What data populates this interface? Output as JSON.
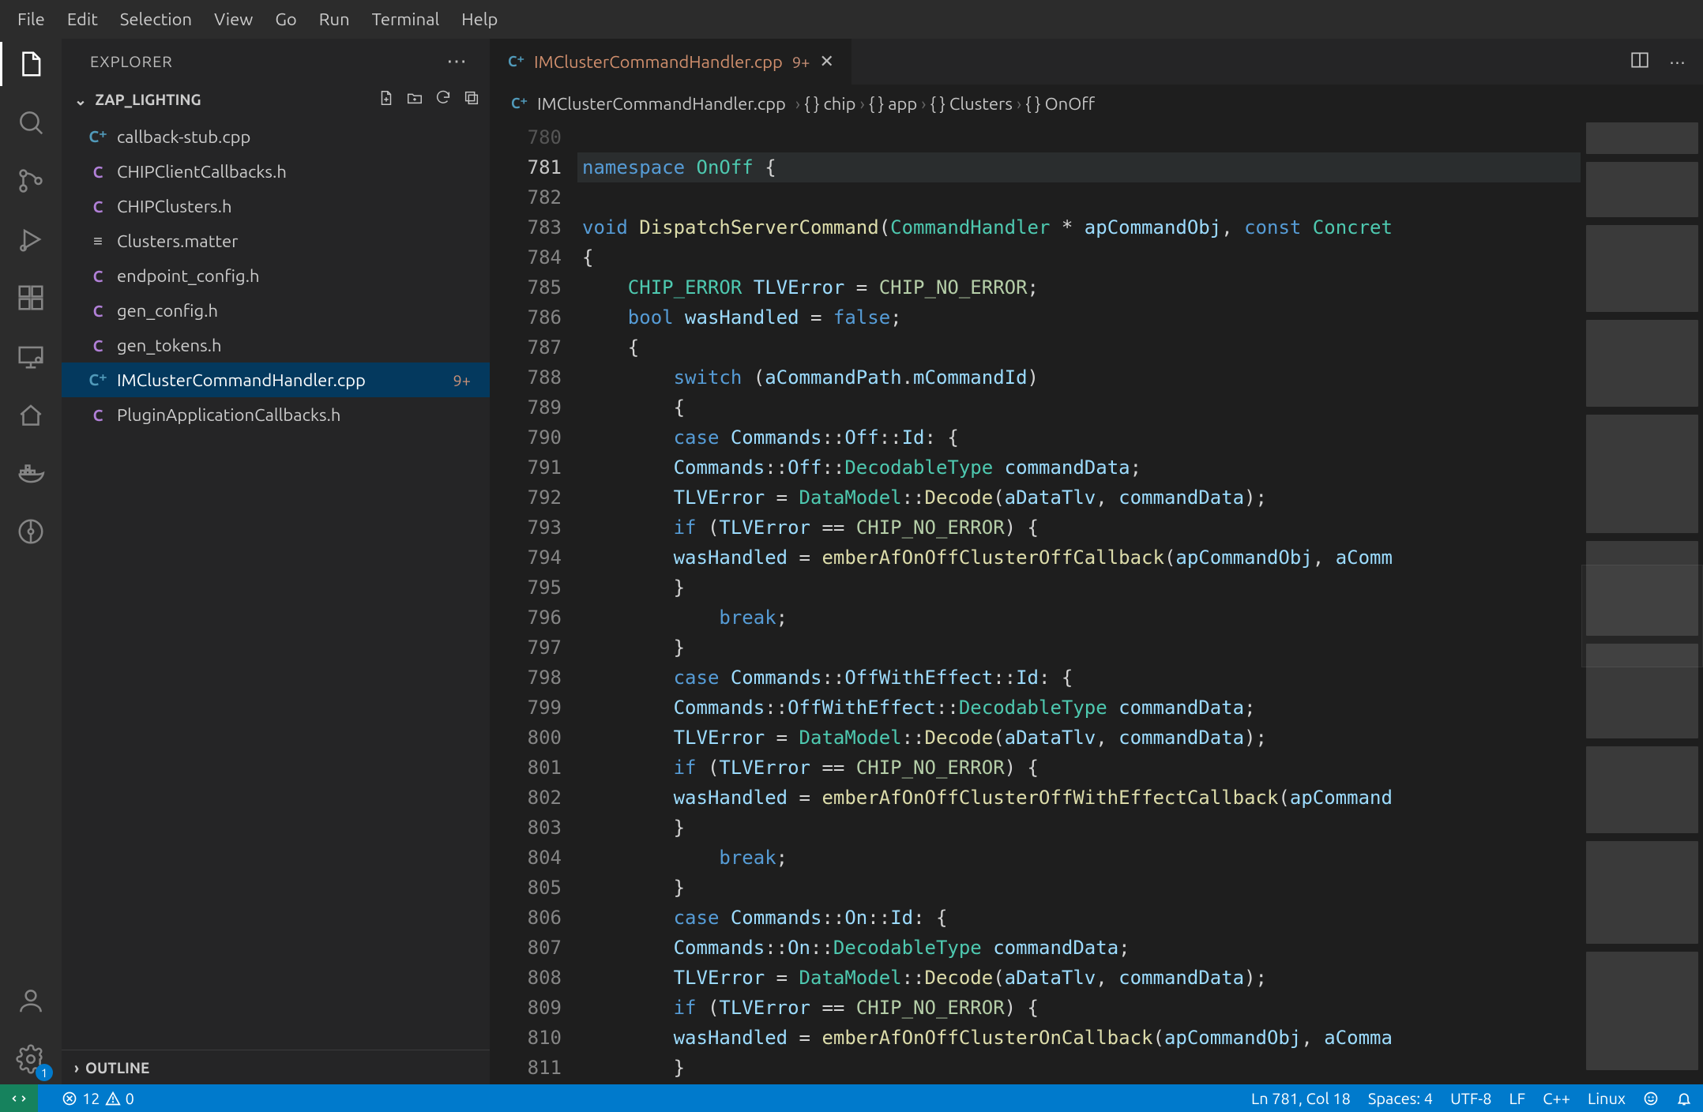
{
  "menu": [
    "File",
    "Edit",
    "Selection",
    "View",
    "Go",
    "Run",
    "Terminal",
    "Help"
  ],
  "activitybar": {
    "top": [
      "explorer",
      "search",
      "scm",
      "run-debug",
      "extensions",
      "remote-explorer",
      "home",
      "docker",
      "graph"
    ],
    "bottom": [
      "account",
      "settings"
    ],
    "active": "explorer",
    "settings_badge": "1"
  },
  "sidebar": {
    "title": "EXPLORER",
    "folder": "ZAP_LIGHTING",
    "files": [
      {
        "icon": "cpp",
        "name": "callback-stub.cpp"
      },
      {
        "icon": "h",
        "name": "CHIPClientCallbacks.h"
      },
      {
        "icon": "h",
        "name": "CHIPClusters.h"
      },
      {
        "icon": "txt",
        "name": "Clusters.matter"
      },
      {
        "icon": "h",
        "name": "endpoint_config.h"
      },
      {
        "icon": "h",
        "name": "gen_config.h"
      },
      {
        "icon": "h",
        "name": "gen_tokens.h"
      },
      {
        "icon": "cpp",
        "name": "IMClusterCommandHandler.cpp",
        "selected": true,
        "mod": "9+"
      },
      {
        "icon": "h",
        "name": "PluginApplicationCallbacks.h"
      }
    ],
    "outline": "OUTLINE"
  },
  "tab": {
    "title": "IMClusterCommandHandler.cpp",
    "mod": "9+"
  },
  "breadcrumb": {
    "file": "IMClusterCommandHandler.cpp",
    "path": [
      "chip",
      "app",
      "Clusters",
      "OnOff"
    ]
  },
  "editor": {
    "first_line": 780,
    "current_line": 781,
    "lines": [
      {
        "n": 780,
        "dim": true,
        "html": ""
      },
      {
        "n": 781,
        "hl": true,
        "html": "<span class='tk-k'>namespace</span> <span class='tk-t'>OnOff</span> {"
      },
      {
        "n": 782,
        "html": ""
      },
      {
        "n": 783,
        "html": "<span class='tk-k'>void</span> <span class='tk-f'>DispatchServerCommand</span>(<span class='tk-t'>CommandHandler</span> * <span class='tk-n'>apCommandObj</span>, <span class='tk-k'>const</span> <span class='tk-t'>Concret</span>"
      },
      {
        "n": 784,
        "html": "{"
      },
      {
        "n": 785,
        "html": "    <span class='tk-t'>CHIP_ERROR</span> <span class='tk-n'>TLVError</span> = <span class='tk-m'>CHIP_NO_ERROR</span>;"
      },
      {
        "n": 786,
        "html": "    <span class='tk-k'>bool</span> <span class='tk-n'>wasHandled</span> = <span class='tk-k'>false</span>;"
      },
      {
        "n": 787,
        "html": "    {"
      },
      {
        "n": 788,
        "html": "        <span class='tk-k'>switch</span> (<span class='tk-n'>aCommandPath</span>.<span class='tk-n'>mCommandId</span>)"
      },
      {
        "n": 789,
        "html": "        {"
      },
      {
        "n": 790,
        "html": "        <span class='tk-k'>case</span> <span class='tk-n'>Commands</span>::<span class='tk-n'>Off</span>::<span class='tk-n'>Id</span>: {"
      },
      {
        "n": 791,
        "html": "        <span class='tk-n'>Commands</span>::<span class='tk-n'>Off</span>::<span class='tk-t'>DecodableType</span> <span class='tk-n'>commandData</span>;"
      },
      {
        "n": 792,
        "html": "        <span class='tk-n'>TLVError</span> = <span class='tk-t'>DataModel</span>::<span class='tk-f'>Decode</span>(<span class='tk-n'>aDataTlv</span>, <span class='tk-n'>commandData</span>);"
      },
      {
        "n": 793,
        "html": "        <span class='tk-k'>if</span> (<span class='tk-n'>TLVError</span> == <span class='tk-m'>CHIP_NO_ERROR</span>) {"
      },
      {
        "n": 794,
        "html": "        <span class='tk-n'>wasHandled</span> = <span class='tk-f'>emberAfOnOffClusterOffCallback</span>(<span class='tk-n'>apCommandObj</span>, <span class='tk-n'>aComm</span>"
      },
      {
        "n": 795,
        "html": "        }"
      },
      {
        "n": 796,
        "html": "            <span class='tk-k'>break</span>;"
      },
      {
        "n": 797,
        "html": "        }"
      },
      {
        "n": 798,
        "html": "        <span class='tk-k'>case</span> <span class='tk-n'>Commands</span>::<span class='tk-n'>OffWithEffect</span>::<span class='tk-n'>Id</span>: {"
      },
      {
        "n": 799,
        "html": "        <span class='tk-n'>Commands</span>::<span class='tk-n'>OffWithEffect</span>::<span class='tk-t'>DecodableType</span> <span class='tk-n'>commandData</span>;"
      },
      {
        "n": 800,
        "html": "        <span class='tk-n'>TLVError</span> = <span class='tk-t'>DataModel</span>::<span class='tk-f'>Decode</span>(<span class='tk-n'>aDataTlv</span>, <span class='tk-n'>commandData</span>);"
      },
      {
        "n": 801,
        "html": "        <span class='tk-k'>if</span> (<span class='tk-n'>TLVError</span> == <span class='tk-m'>CHIP_NO_ERROR</span>) {"
      },
      {
        "n": 802,
        "html": "        <span class='tk-n'>wasHandled</span> = <span class='tk-f'>emberAfOnOffClusterOffWithEffectCallback</span>(<span class='tk-n'>apCommand</span>"
      },
      {
        "n": 803,
        "html": "        }"
      },
      {
        "n": 804,
        "html": "            <span class='tk-k'>break</span>;"
      },
      {
        "n": 805,
        "html": "        }"
      },
      {
        "n": 806,
        "html": "        <span class='tk-k'>case</span> <span class='tk-n'>Commands</span>::<span class='tk-n'>On</span>::<span class='tk-n'>Id</span>: {"
      },
      {
        "n": 807,
        "html": "        <span class='tk-n'>Commands</span>::<span class='tk-n'>On</span>::<span class='tk-t'>DecodableType</span> <span class='tk-n'>commandData</span>;"
      },
      {
        "n": 808,
        "html": "        <span class='tk-n'>TLVError</span> = <span class='tk-t'>DataModel</span>::<span class='tk-f'>Decode</span>(<span class='tk-n'>aDataTlv</span>, <span class='tk-n'>commandData</span>);"
      },
      {
        "n": 809,
        "html": "        <span class='tk-k'>if</span> (<span class='tk-n'>TLVError</span> == <span class='tk-m'>CHIP_NO_ERROR</span>) {"
      },
      {
        "n": 810,
        "html": "        <span class='tk-n'>wasHandled</span> = <span class='tk-f'>emberAfOnOffClusterOnCallback</span>(<span class='tk-n'>apCommandObj</span>, <span class='tk-n'>aComma</span>"
      },
      {
        "n": 811,
        "html": "        }"
      }
    ]
  },
  "status": {
    "errors": "12",
    "warnings": "0",
    "cursor": "Ln 781, Col 18",
    "spaces": "Spaces: 4",
    "encoding": "UTF-8",
    "eol": "LF",
    "language": "C++",
    "os": "Linux"
  }
}
